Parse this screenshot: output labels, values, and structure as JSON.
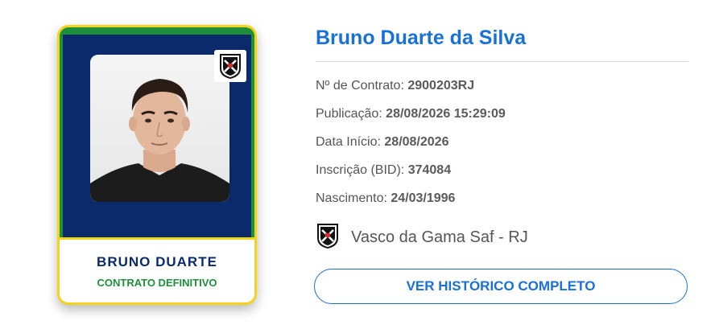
{
  "card": {
    "name": "BRUNO DUARTE",
    "status": "CONTRATO DEFINITIVO",
    "crest_icon": "vasco-crest-icon",
    "colors": {
      "navy": "#0b2a6b",
      "yellow": "#f3d417",
      "green": "#1d8f3a"
    }
  },
  "player": {
    "full_name": "Bruno Duarte da Silva",
    "contract_label": "Nº de Contrato:",
    "contract_value": "2900203RJ",
    "publication_label": "Publicação:",
    "publication_value": "28/08/2026 15:29:09",
    "start_label": "Data Início:",
    "start_value": "28/08/2026",
    "bid_label": "Inscrição (BID):",
    "bid_value": "374084",
    "birth_label": "Nascimento:",
    "birth_value": "24/03/1996"
  },
  "club": {
    "name": "Vasco da Gama Saf - RJ",
    "icon": "vasco-crest-icon"
  },
  "actions": {
    "history_label": "VER HISTÓRICO COMPLETO"
  },
  "theme": {
    "accent": "#1971d6",
    "text": "#555555"
  }
}
